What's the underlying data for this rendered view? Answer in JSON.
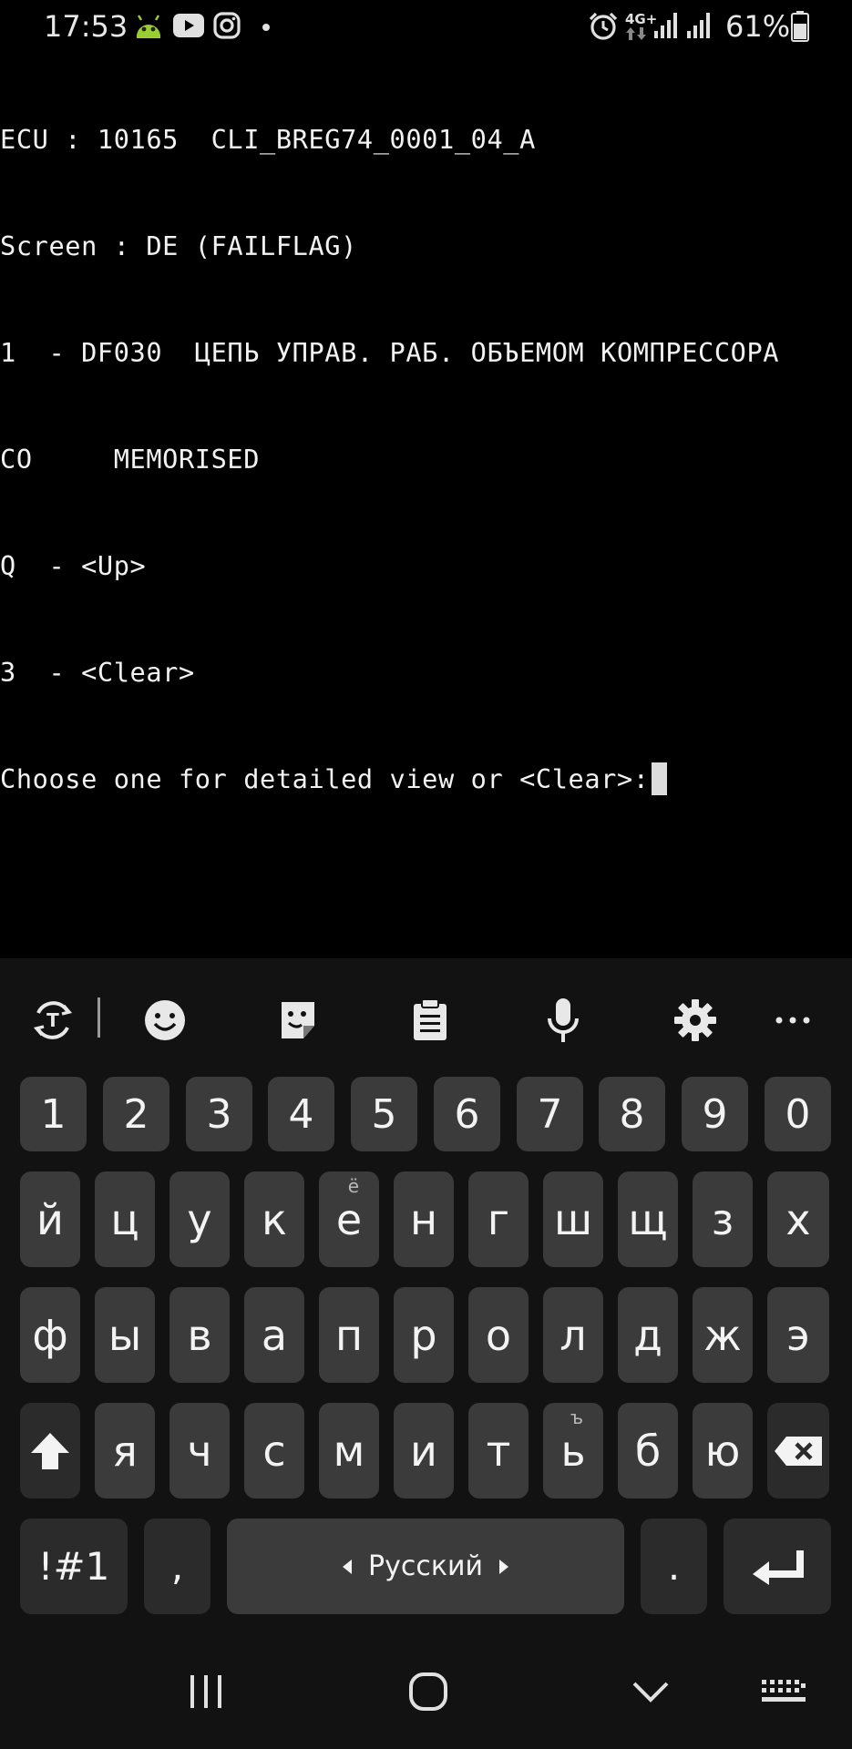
{
  "status_bar": {
    "time": "17:53",
    "network": "4G+",
    "battery": "61%",
    "notification_icons": [
      "android-icon",
      "youtube-icon",
      "instagram-icon",
      "dot-icon"
    ],
    "system_icons": [
      "alarm-icon",
      "signal-icon",
      "signal-icon",
      "battery-icon"
    ]
  },
  "terminal": {
    "lines": [
      "ECU : 10165  CLI_BREG74_0001_04_A",
      "Screen : DE (FAILFLAG)",
      "1  - DF030  ЦЕПЬ УПРАВ. РАБ. ОБЪЕМОМ КОМПРЕССОРА",
      "CO     MEMORISED",
      "Q  - <Up>",
      "3  - <Clear>",
      "Choose one for detailed view or <Clear>:"
    ]
  },
  "keyboard": {
    "toolbar": [
      "translate-icon",
      "emoji-icon",
      "sticker-icon",
      "clipboard-icon",
      "mic-icon",
      "settings-icon",
      "more-icon"
    ],
    "row_numbers": [
      "1",
      "2",
      "3",
      "4",
      "5",
      "6",
      "7",
      "8",
      "9",
      "0"
    ],
    "row1": [
      "й",
      "ц",
      "у",
      "к",
      "е",
      "н",
      "г",
      "ш",
      "щ",
      "з",
      "х"
    ],
    "row1_hint_e": "ё",
    "row2": [
      "ф",
      "ы",
      "в",
      "а",
      "п",
      "р",
      "о",
      "л",
      "д",
      "ж",
      "э"
    ],
    "row3": [
      "я",
      "ч",
      "с",
      "м",
      "и",
      "т",
      "ь",
      "б",
      "ю"
    ],
    "row3_hint_soft": "ъ",
    "symbols_label": "!#1",
    "comma_label": ",",
    "space_label": "Русский",
    "period_label": "."
  },
  "colors": {
    "background": "#000000",
    "keyboard_bg": "#121212",
    "key_bg": "#3b3b3b",
    "text": "#f2f2f2"
  }
}
